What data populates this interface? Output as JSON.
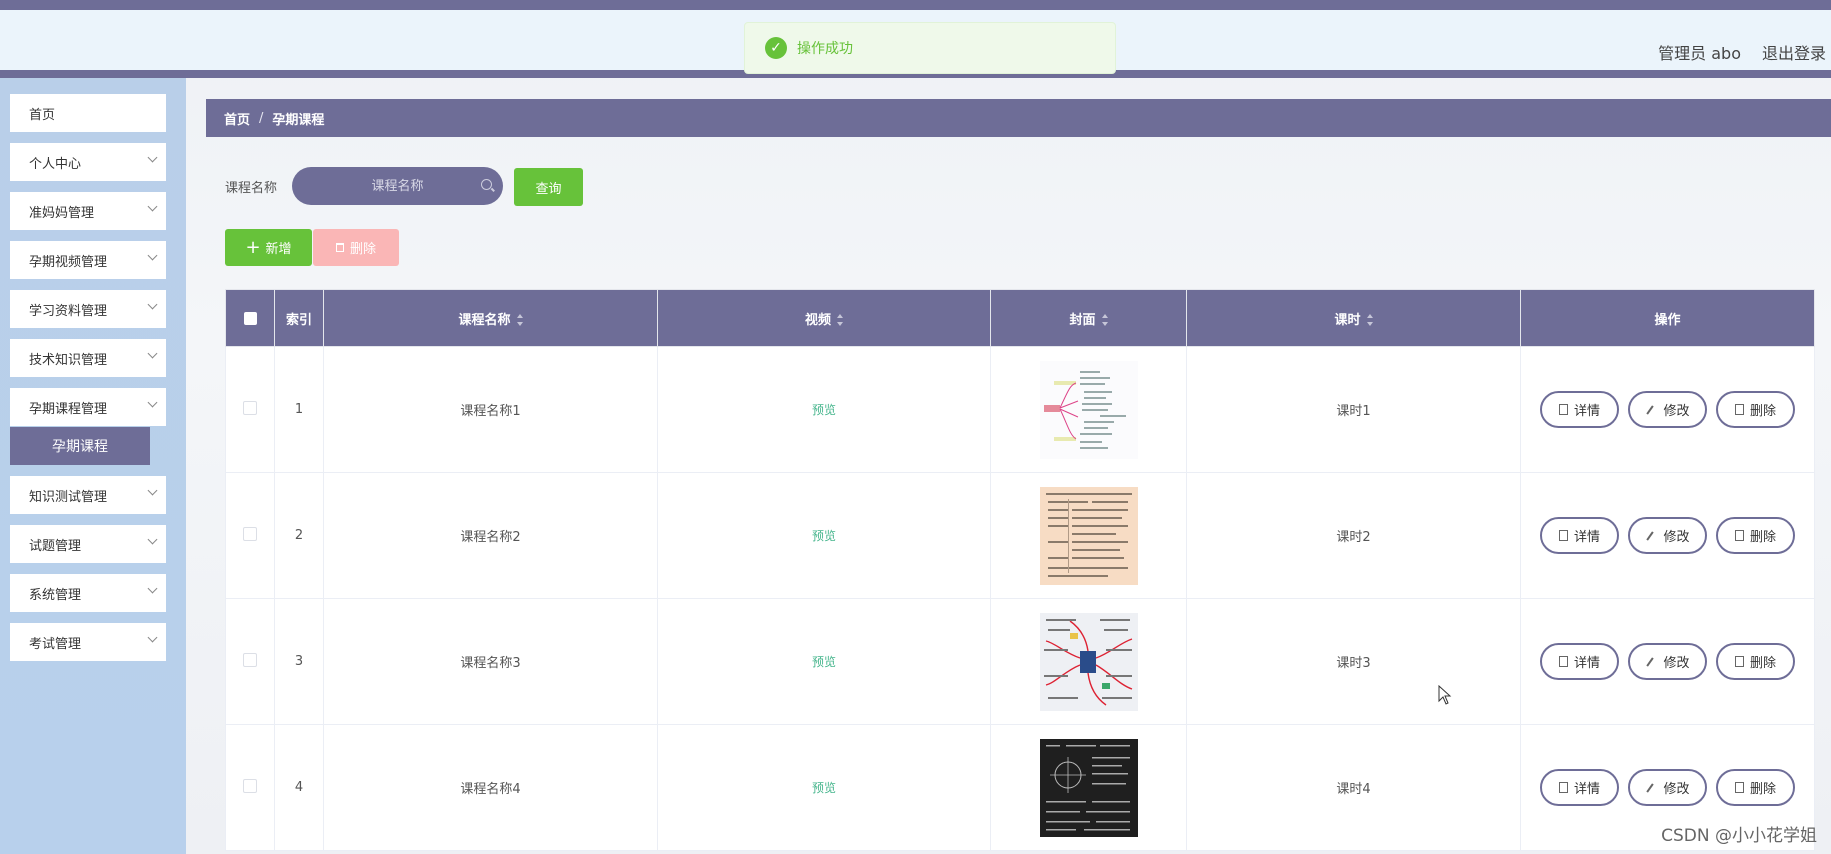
{
  "header": {
    "user_label": "管理员 abo",
    "logout_label": "退出登录"
  },
  "toast": {
    "message": "操作成功",
    "icon": "check-circle-icon"
  },
  "sidebar": {
    "items": [
      {
        "label": "首页",
        "has_arrow": false
      },
      {
        "label": "个人中心",
        "has_arrow": true
      },
      {
        "label": "准妈妈管理",
        "has_arrow": true
      },
      {
        "label": "孕期视频管理",
        "has_arrow": true
      },
      {
        "label": "学习资料管理",
        "has_arrow": true
      },
      {
        "label": "技术知识管理",
        "has_arrow": true
      },
      {
        "label": "孕期课程管理",
        "has_arrow": true
      },
      {
        "label": "知识测试管理",
        "has_arrow": true
      },
      {
        "label": "试题管理",
        "has_arrow": true
      },
      {
        "label": "系统管理",
        "has_arrow": true
      },
      {
        "label": "考试管理",
        "has_arrow": true
      }
    ],
    "active_sub": "孕期课程"
  },
  "breadcrumb": {
    "home": "首页",
    "separator": "/",
    "current": "孕期课程"
  },
  "search": {
    "label": "课程名称",
    "placeholder": "课程名称",
    "query_label": "查询"
  },
  "actions": {
    "add_label": "新增",
    "delete_label": "删除"
  },
  "table": {
    "headers": {
      "index": "索引",
      "name": "课程名称",
      "video": "视频",
      "cover": "封面",
      "hours": "课时",
      "ops": "操作"
    },
    "rows": [
      {
        "index": "1",
        "name": "课程名称1",
        "video": "预览",
        "hours": "课时1",
        "cover": "mindmap-light"
      },
      {
        "index": "2",
        "name": "课程名称2",
        "video": "预览",
        "hours": "课时2",
        "cover": "document-peach"
      },
      {
        "index": "3",
        "name": "课程名称3",
        "video": "预览",
        "hours": "课时3",
        "cover": "mindmap-color"
      },
      {
        "index": "4",
        "name": "课程名称4",
        "video": "预览",
        "hours": "课时4",
        "cover": "blackboard"
      }
    ],
    "row_actions": {
      "detail": "详情",
      "edit": "修改",
      "delete": "删除"
    }
  },
  "watermark": "CSDN @小小花学姐",
  "colors": {
    "primary": "#6e6d97",
    "success": "#67c23a",
    "danger_light": "#fab6b6",
    "sidebar_bg": "#b9cfe9"
  }
}
